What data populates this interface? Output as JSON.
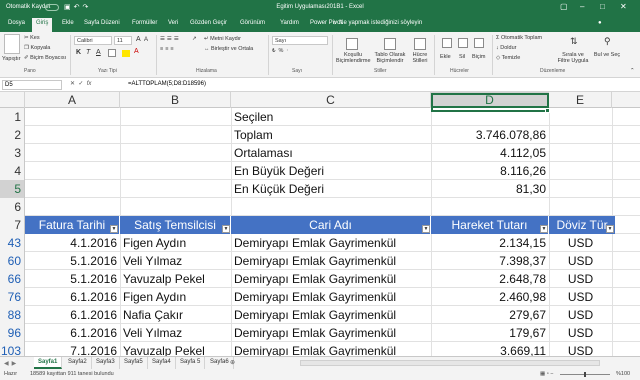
{
  "titlebar": {
    "autosave": "Otomatik Kaydet",
    "title": "Egitim Uygulaması201B1 - Excel"
  },
  "tabs": [
    "Dosya",
    "Giriş",
    "Ekle",
    "Sayfa Düzeni",
    "Formüller",
    "Veri",
    "Gözden Geçir",
    "Görünüm",
    "Yardım",
    "Power Pivot"
  ],
  "active_tab": "Giriş",
  "tellme": "Ne yapmak istediğinizi söyleyin",
  "ribbon": {
    "clipboard": {
      "cut": "Kes",
      "copy": "Kopyala",
      "format_painter": "Biçim Boyacısı",
      "paste": "Yapıştır",
      "group": "Pano"
    },
    "font": {
      "name": "Calibri",
      "size": "11",
      "group": "Yazı Tipi"
    },
    "alignment": {
      "wrap": "Metni Kaydır",
      "merge": "Birleştir ve Ortala",
      "group": "Hizalama"
    },
    "number": {
      "format": "Sayı",
      "group": "Sayı"
    },
    "styles": {
      "cond": "Koşullu Biçimlendirme",
      "table": "Tablo Olarak Biçimlendir",
      "cell": "Hücre Stilleri",
      "group": "Stiller"
    },
    "cells": {
      "insert": "Ekle",
      "delete": "Sil",
      "format": "Biçim",
      "group": "Hücreler"
    },
    "editing": {
      "autosum": "Otomatik Toplam",
      "fill": "Doldur",
      "clear": "Temizle",
      "sort": "Sırala ve Filtre Uygula",
      "find": "Bul ve Seç",
      "group": "Düzenleme"
    }
  },
  "formula_bar": {
    "name_box": "D5",
    "formula": "=ALTTOPLAM(5;D8:D18596)"
  },
  "columns": [
    "A",
    "B",
    "C",
    "D",
    "E"
  ],
  "selected_column": "D",
  "rows": [
    {
      "num": "1",
      "C": "Seçilen",
      "D": ""
    },
    {
      "num": "2",
      "C": "Toplam",
      "D": "3.746.078,86"
    },
    {
      "num": "3",
      "C": "Ortalaması",
      "D": "4.112,05"
    },
    {
      "num": "4",
      "C": "En Büyük Değeri",
      "D": "8.116,26"
    },
    {
      "num": "5",
      "C": "En Küçük Değeri",
      "D": "81,30"
    },
    {
      "num": "6",
      "C": "",
      "D": ""
    }
  ],
  "table_header": {
    "num": "7",
    "A": "Fatura Tarihi",
    "B": "Satış Temsilcisi",
    "C": "Cari Adı",
    "D": "Hareket Tutarı",
    "E": "Döviz Tür"
  },
  "data_rows": [
    {
      "num": "43",
      "A": "4.1.2016",
      "B": "Figen Aydın",
      "C": "Demiryapı Emlak Gayrimenkül",
      "D": "2.134,15",
      "E": "USD"
    },
    {
      "num": "60",
      "A": "5.1.2016",
      "B": "Veli Yılmaz",
      "C": "Demiryapı Emlak Gayrimenkül",
      "D": "7.398,37",
      "E": "USD"
    },
    {
      "num": "66",
      "A": "5.1.2016",
      "B": "Yavuzalp Pekel",
      "C": "Demiryapı Emlak Gayrimenkül",
      "D": "2.648,78",
      "E": "USD"
    },
    {
      "num": "76",
      "A": "6.1.2016",
      "B": "Figen Aydın",
      "C": "Demiryapı Emlak Gayrimenkül",
      "D": "2.460,98",
      "E": "USD"
    },
    {
      "num": "88",
      "A": "6.1.2016",
      "B": "Nafia Çakır",
      "C": "Demiryapı Emlak Gayrimenkül",
      "D": "279,67",
      "E": "USD"
    },
    {
      "num": "96",
      "A": "6.1.2016",
      "B": "Veli Yılmaz",
      "C": "Demiryapı Emlak Gayrimenkül",
      "D": "179,67",
      "E": "USD"
    },
    {
      "num": "103",
      "A": "7.1.2016",
      "B": "Yavuzalp Pekel",
      "C": "Demiryapı Emlak Gayrimenkül",
      "D": "3.669,11",
      "E": "USD"
    }
  ],
  "sheets": [
    "Sayfa1",
    "Sayfa2",
    "Sayfa3",
    "Sayfa5",
    "Sayfa4",
    "Sayfa 5",
    "Sayfa6"
  ],
  "active_sheet": "Sayfa1",
  "status": {
    "ready": "Hazır",
    "filter": "18589 kayıttan 911 tanesi bulundu",
    "zoom": "%100"
  },
  "colors": {
    "brand": "#217346",
    "table_header": "#4472c4",
    "filtered_row": "#1f5fb5"
  }
}
